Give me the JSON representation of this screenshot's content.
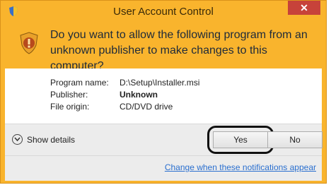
{
  "dialog": {
    "title": "User Account Control",
    "close_glyph": "✕",
    "question": "Do you want to allow the following program from an unknown publisher to make changes to this computer?",
    "info": [
      {
        "label": "Program name:",
        "value": "D:\\Setup\\Installer.msi"
      },
      {
        "label": "Publisher:",
        "value": "Unknown"
      },
      {
        "label": "File origin:",
        "value": "CD/DVD drive"
      }
    ],
    "show_details_label": "Show details",
    "yes_label": "Yes",
    "no_label": "No",
    "link_text": "Change when these notifications appear"
  },
  "colors": {
    "header": "#f9b42d",
    "close": "#c7423a",
    "link": "#2a6fcf"
  },
  "icons": {
    "title": "uac-shield-icon",
    "main": "shield-icon",
    "details": "chevron-down-circle-icon"
  }
}
